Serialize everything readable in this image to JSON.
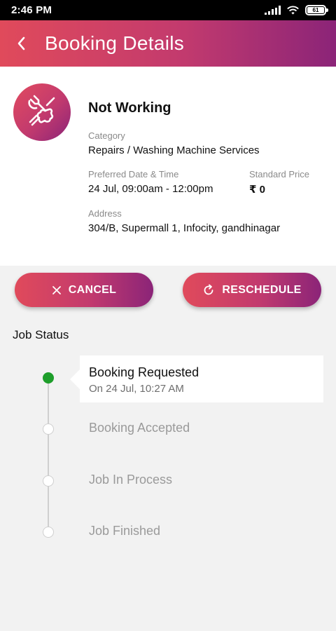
{
  "status_bar": {
    "time": "2:46 PM",
    "battery": "61"
  },
  "header": {
    "title": "Booking Details"
  },
  "booking": {
    "title": "Not Working",
    "category_label": "Category",
    "category_value": "Repairs / Washing Machine Services",
    "date_label": "Preferred Date & Time",
    "date_value": "24 Jul, 09:00am - 12:00pm",
    "price_label": "Standard Price",
    "price_value": "₹ 0",
    "address_label": "Address",
    "address_value": "304/B, Supermall 1, Infocity, gandhinagar"
  },
  "actions": {
    "cancel_label": "CANCEL",
    "reschedule_label": "RESCHEDULE"
  },
  "job_status": {
    "title": "Job Status",
    "steps": [
      {
        "label": "Booking Requested",
        "time": "On 24 Jul, 10:27 AM",
        "active": true
      },
      {
        "label": "Booking Accepted",
        "active": false
      },
      {
        "label": "Job In Process",
        "active": false
      },
      {
        "label": "Job Finished",
        "active": false
      }
    ]
  },
  "colors": {
    "gradient_start": "#e04a5b",
    "gradient_end": "#8b2478",
    "active_dot": "#1e9e2b"
  }
}
